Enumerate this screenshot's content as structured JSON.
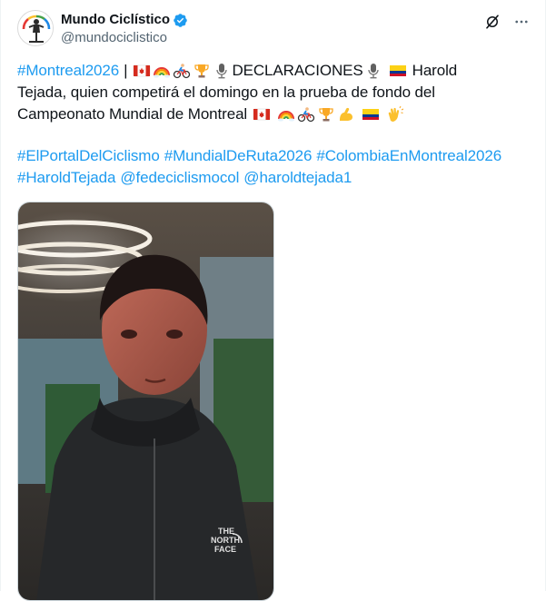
{
  "author": {
    "display_name": "Mundo Ciclístico",
    "handle": "@mundociclistico",
    "verified_color": "#1d9bf0",
    "avatar_icon": "cyclist-logo-icon"
  },
  "actions": {
    "grok_icon": "grok-icon",
    "more_icon": "more-icon"
  },
  "tweet": {
    "hashtag_montreal": "#Montreal2026",
    "separator": "|",
    "declaraciones": "DECLARACIONES",
    "text_harold": "Harold",
    "text_line2": "Tejada, quien competirá el domingo en la prueba de fondo del",
    "text_line3": "Campeonato Mundial de Montreal",
    "hashtag_portal": "#ElPortalDelCiclismo",
    "hashtag_mundial": "#MundialDeRuta2026",
    "hashtag_colombia": "#ColombiaEnMontreal2026",
    "hashtag_harold": "#HaroldTejada",
    "mention_fede": "@fedeciclismocol",
    "mention_harold": "@haroldtejada1"
  },
  "emojis": {
    "line1_a": [
      "canada-flag",
      "rainbow",
      "cyclist",
      "trophy",
      "microphone"
    ],
    "line1_b": [
      "microphone",
      "colombia-flag"
    ],
    "line3": [
      "canada-flag",
      "rainbow",
      "cyclist",
      "trophy",
      "flexed-bicep",
      "colombia-flag",
      "clapping-hands"
    ]
  },
  "media": {
    "type": "video",
    "logo_text": "THE NORTH FACE"
  },
  "colors": {
    "link": "#1d9bf0",
    "text": "#0f1419",
    "secondary": "#536471"
  }
}
